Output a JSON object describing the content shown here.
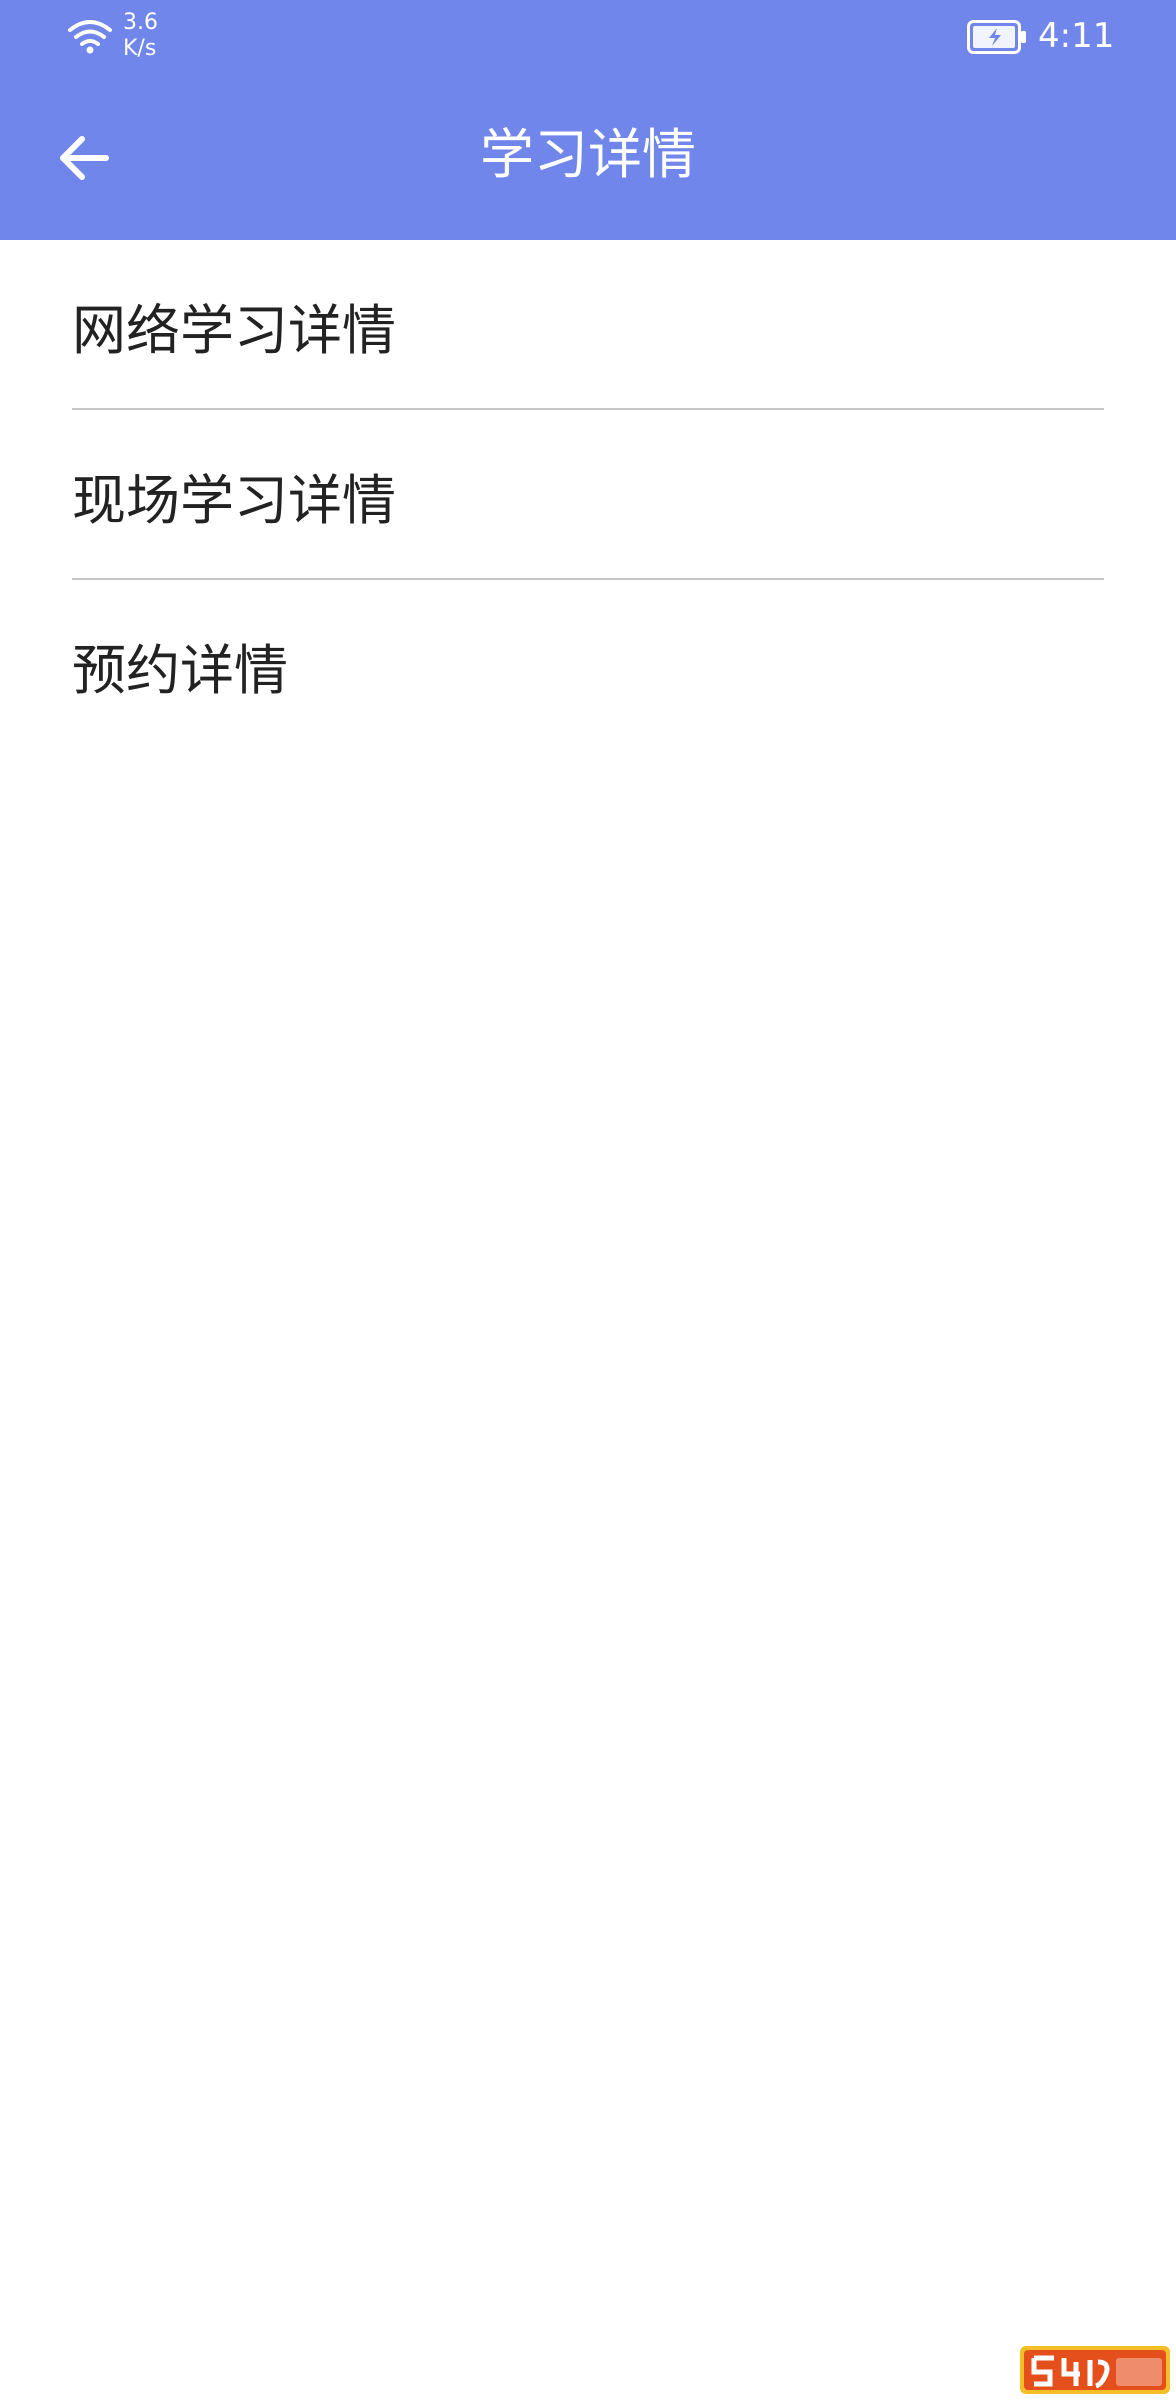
{
  "status_bar": {
    "net_speed_value": "3.6",
    "net_speed_unit": "K/s",
    "time": "4:11",
    "icons": [
      "wifi-icon",
      "battery-charging-icon"
    ]
  },
  "header": {
    "title": "学习详情",
    "back_icon": "arrow-left-icon"
  },
  "menu": {
    "items": [
      {
        "label": "网络学习详情"
      },
      {
        "label": "现场学习详情"
      },
      {
        "label": "预约详情"
      }
    ]
  },
  "colors": {
    "header_bg": "#7086EA",
    "text": "#222222",
    "divider": "#C8C8C8",
    "background": "#FFFFFF"
  }
}
